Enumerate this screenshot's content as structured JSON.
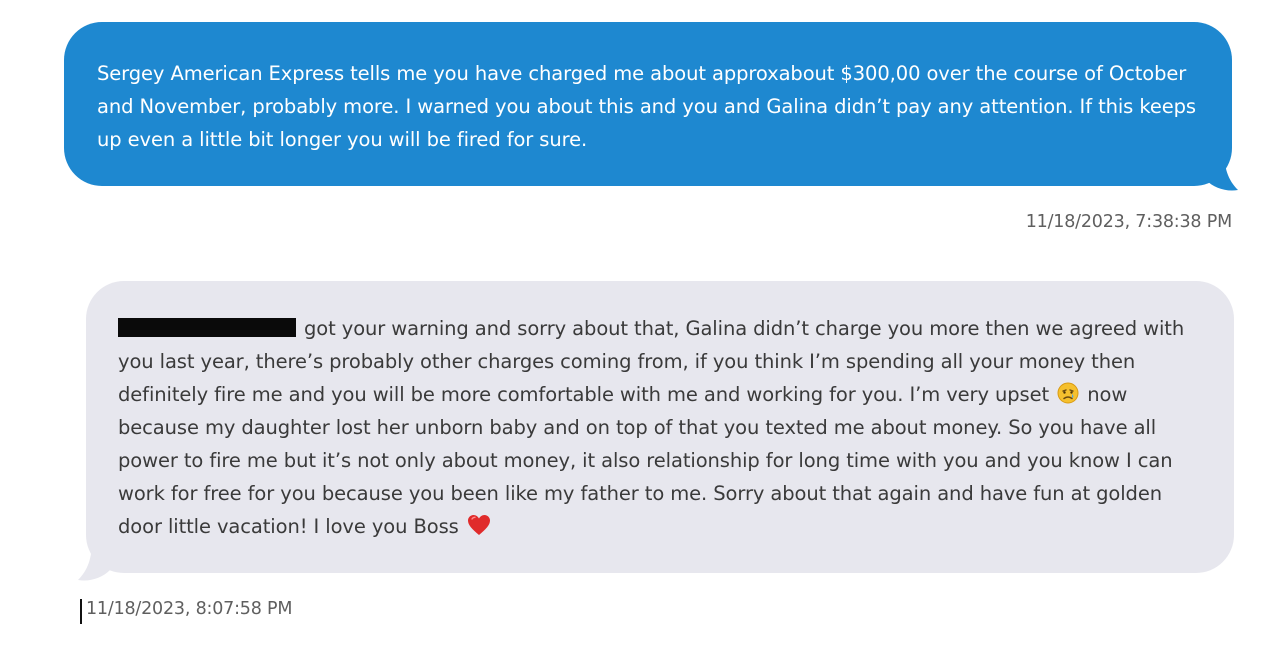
{
  "messages": [
    {
      "direction": "outgoing",
      "text": "Sergey American Express tells me you have charged me about approxabout $300,00 over the course of October and November, probably more. I warned you about this and you and Galina didn’t pay any attention. If this keeps up even a little bit longer you will be fired for sure.",
      "timestamp": "11/18/2023, 7:38:38 PM",
      "bubble_color": "#1e88d0"
    },
    {
      "direction": "incoming",
      "text_part1": "got your warning and sorry about that, Galina didn’t charge you more then we agreed with you last year, there’s probably other charges coming from, if you think I’m spending all your money then definitely fire me and you will be more comfortable with me and working for you. I’m very upset",
      "emoji_1": "crying-face-emoji",
      "text_part2": "now because my daughter lost her unborn baby and on top of that you texted me about money. So you have all power to fire me but it’s not only about money, it also relationship for long time with you and you know I can work for free for you because you been like my father to me. Sorry about that again and have fun at golden door little vacation! I love you Boss",
      "emoji_2": "red-heart-emoji",
      "redacted_name": true,
      "timestamp": "11/18/2023, 8:07:58 PM",
      "bubble_color": "#e7e7ee"
    }
  ]
}
